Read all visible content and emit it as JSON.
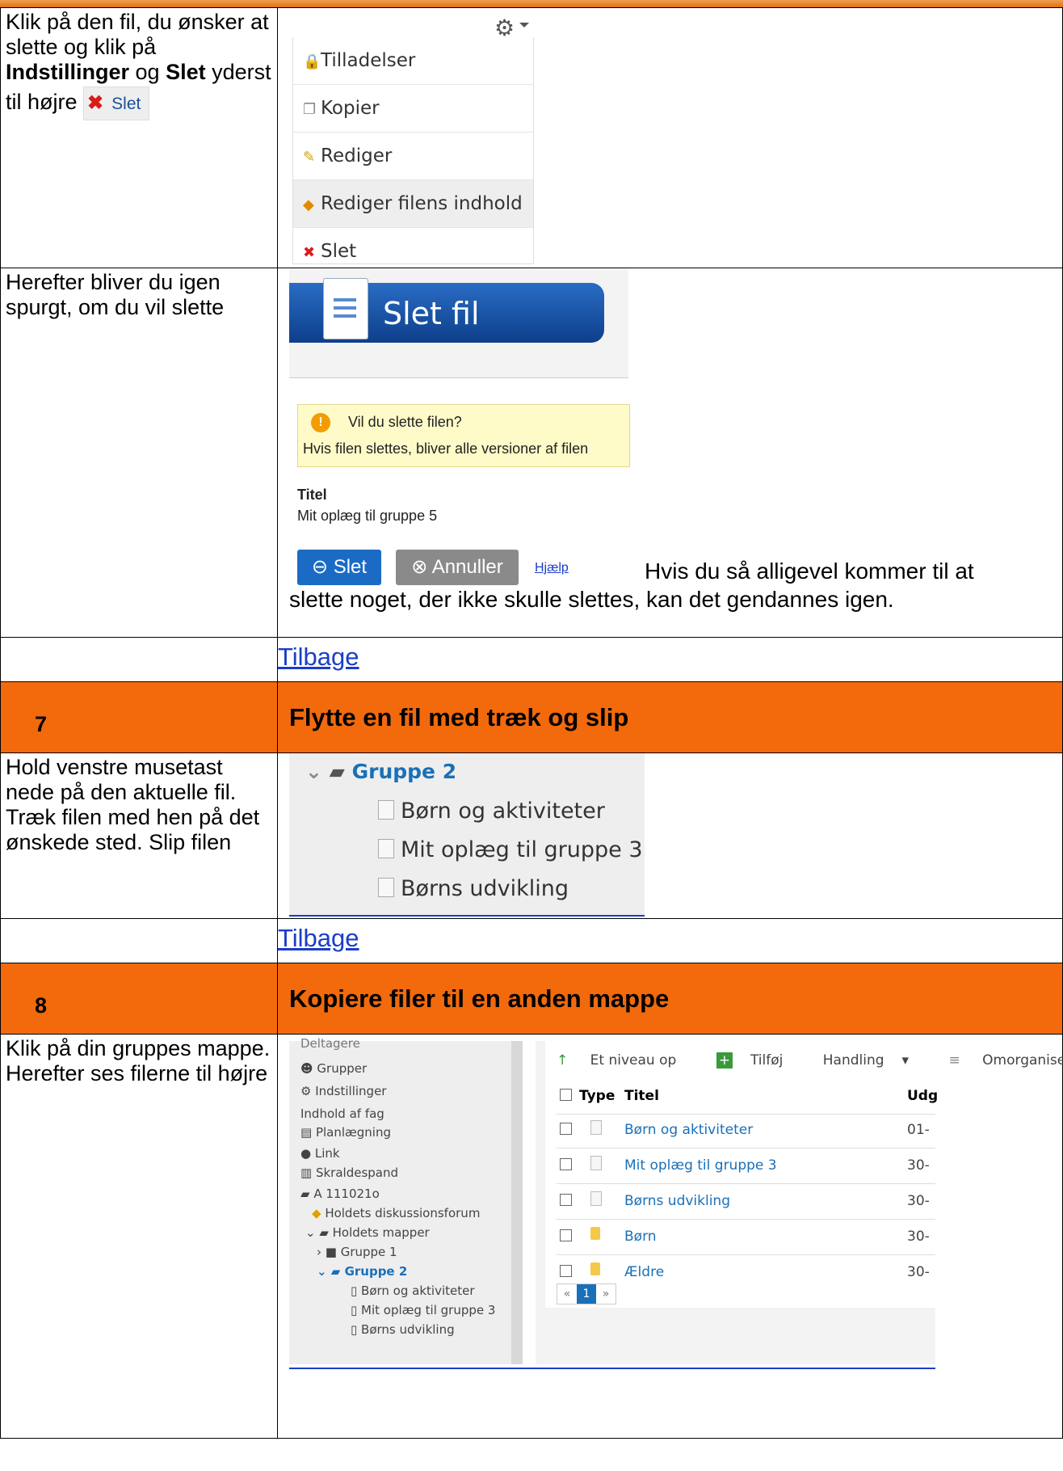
{
  "row1": {
    "left_text_1": "Klik på den fil, du ønsker at slette og klik på ",
    "left_bold_1": "Indstillinger",
    "left_text_2": " og ",
    "left_bold_2": "Slet",
    "left_text_3": " yderst til højre",
    "slet_label": "Slet",
    "menu": [
      "Tilladelser",
      "Kopier",
      "Rediger",
      "Rediger filens indhold",
      "Slet"
    ]
  },
  "row2": {
    "left_text": "Herefter bliver du igen spurgt, om du vil slette",
    "dialog_title": "Slet fil",
    "warn_question": "Vil du slette filen?",
    "warn_detail": "Hvis filen slettes, bliver alle versioner af filen",
    "title_label": "Titel",
    "title_value": "Mit oplæg til gruppe 5",
    "btn_delete": "Slet",
    "btn_cancel": "Annuller",
    "help": "Hjælp",
    "after_text_1": "Hvis du så alligevel kommer til at",
    "after_text_2": "slette noget, der ikke skulle slettes, kan det gendannes igen."
  },
  "back_link": "Tilbage",
  "section7": {
    "number": "7",
    "title": "Flytte en fil med træk og slip"
  },
  "row7": {
    "left_text": "Hold venstre musetast nede på den aktuelle fil. Træk filen med hen på det ønskede sted. Slip filen",
    "folder": "Gruppe 2",
    "files": [
      "Børn og aktiviteter",
      "Mit oplæg til gruppe 3",
      "Børns udvikling"
    ]
  },
  "section8": {
    "number": "8",
    "title": "Kopiere filer til en anden mappe"
  },
  "row8": {
    "left_text": "Klik på din gruppes mappe. Herefter ses filerne til højre",
    "sidebar": [
      "Deltagere",
      "Grupper",
      "Indstillinger",
      "Indhold af fag",
      "Planlægning",
      "Link",
      "Skraldespand",
      "A 111021o",
      "Holdets diskussionsforum",
      "Holdets mapper",
      "Gruppe 1",
      "Gruppe 2",
      "Børn og aktiviteter",
      "Mit oplæg til gruppe 3",
      "Børns udvikling"
    ],
    "toolbar": [
      "Et niveau op",
      "Tilføj",
      "Handling",
      "Omorganise"
    ],
    "col_type": "Type",
    "col_title": "Titel",
    "col_date": "Udg",
    "rows": [
      {
        "title": "Børn og aktiviteter",
        "date": "01-",
        "kind": "file"
      },
      {
        "title": "Mit oplæg til gruppe 3",
        "date": "30-",
        "kind": "file"
      },
      {
        "title": "Børns udvikling",
        "date": "30-",
        "kind": "file"
      },
      {
        "title": "Børn",
        "date": "30-",
        "kind": "folder"
      },
      {
        "title": "Ældre",
        "date": "30-",
        "kind": "folder"
      }
    ],
    "pager": [
      "«",
      "1",
      "»"
    ]
  },
  "colors": {
    "orange": "#f26a0c",
    "link": "#1a3ec8"
  }
}
